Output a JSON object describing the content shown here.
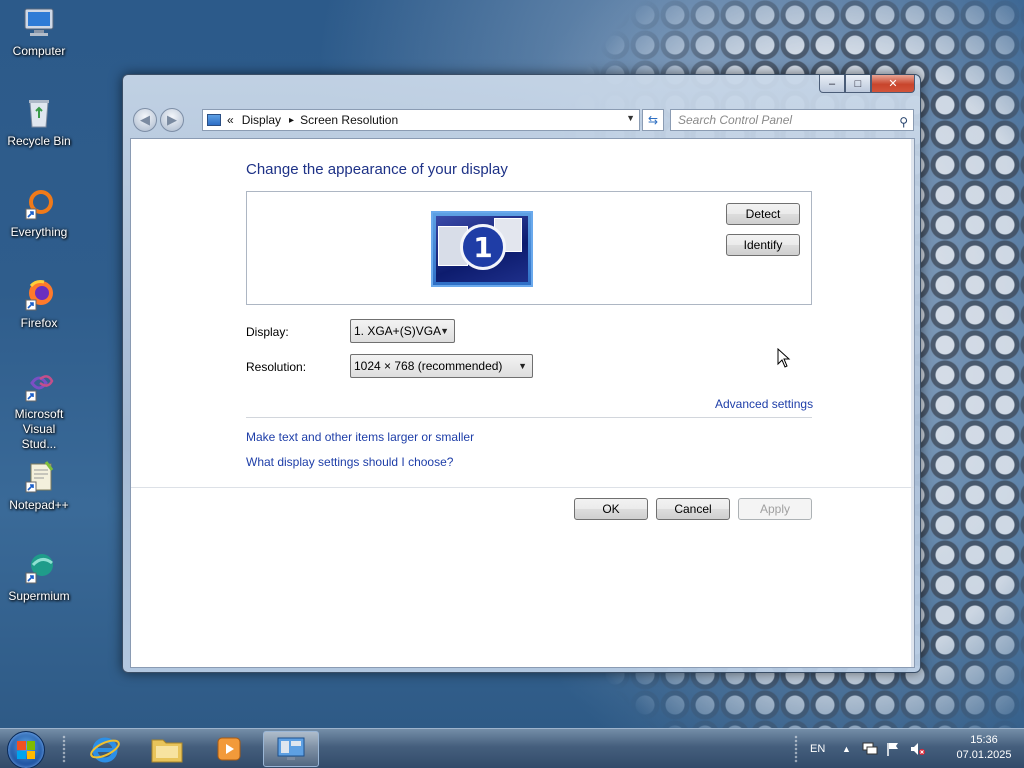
{
  "desktop": {
    "icons": [
      {
        "label": "Computer"
      },
      {
        "label": "Recycle Bin"
      },
      {
        "label": "Everything"
      },
      {
        "label": "Firefox"
      },
      {
        "label": "Microsoft Visual Stud..."
      },
      {
        "label": "Notepad++"
      },
      {
        "label": "Supermium"
      }
    ]
  },
  "window": {
    "caption": {
      "minimize": "–",
      "maximize": "□",
      "close": "✕"
    },
    "nav": {
      "back": "◀",
      "forward": "▶"
    },
    "address": {
      "prefix": "«",
      "crumb1": "Display",
      "separator": "▸",
      "crumb2": "Screen Resolution"
    },
    "search": {
      "placeholder": "Search Control Panel"
    },
    "content": {
      "heading": "Change the appearance of your display",
      "monitor_number": "1",
      "detect_button": "Detect",
      "identify_button": "Identify",
      "display_label": "Display:",
      "display_value": "1. XGA+(S)VGA",
      "resolution_label": "Resolution:",
      "resolution_value": "1024 × 768 (recommended)",
      "advanced_link": "Advanced settings",
      "link_text_size": "Make text and other items larger or smaller",
      "link_choose": "What display settings should I choose?",
      "ok_button": "OK",
      "cancel_button": "Cancel",
      "apply_button": "Apply"
    }
  },
  "taskbar": {
    "language": "EN",
    "time": "15:36",
    "date": "07.01.2025"
  },
  "colors": {
    "heading": "#1e3287",
    "link": "#1e3ea8",
    "close_button": "#c8452c"
  }
}
